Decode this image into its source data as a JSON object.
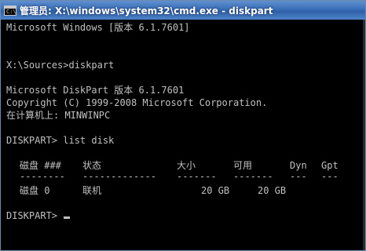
{
  "window": {
    "title": "管理员: X:\\windows\\system32\\cmd.exe - diskpart",
    "icon": "cmd-console-icon"
  },
  "console": {
    "lines": [
      "Microsoft Windows [版本 6.1.7601]",
      "X:\\Sources>diskpart",
      "Microsoft DiskPart 版本 6.1.7601",
      "Copyright (C) 1999-2008 Microsoft Corporation.",
      "在计算机上: MINWINPC",
      "DISKPART> list disk"
    ],
    "table": {
      "headers": [
        "磁盘 ###",
        "状态",
        "大小",
        "可用",
        "Dyn",
        "Gpt"
      ],
      "separators": [
        "--------",
        "-------------",
        "-------",
        "-------",
        "---",
        "---"
      ],
      "rows": [
        {
          "disk": "磁盘 0",
          "status": "联机",
          "size": "20 GB",
          "free": "20 GB",
          "dyn": "",
          "gpt": ""
        }
      ]
    },
    "final_prompt": "DISKPART> "
  },
  "colors": {
    "background": "#000000",
    "text": "#c0c0c0",
    "titlebar": "#3a6fb8"
  }
}
